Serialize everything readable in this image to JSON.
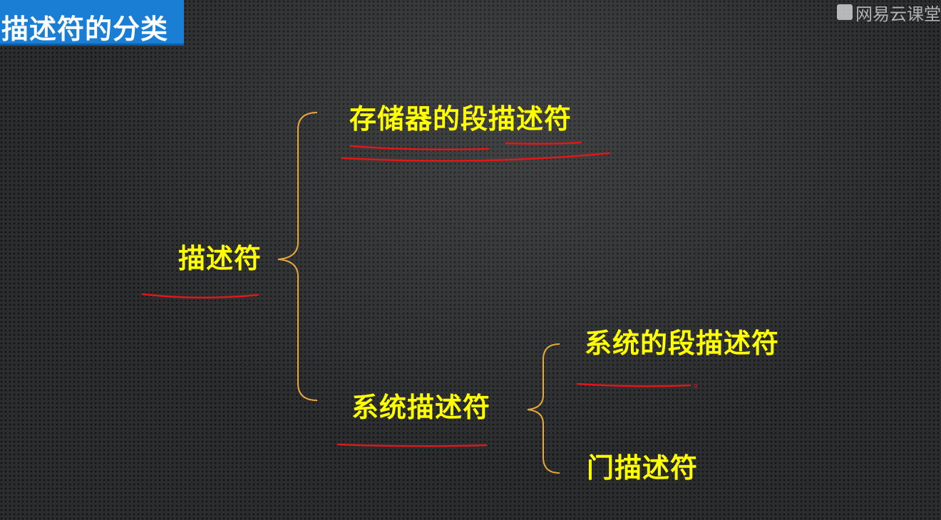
{
  "title": "描述符的分类",
  "watermark": "网易云课堂",
  "tree": {
    "root": "描述符",
    "branches": [
      {
        "label": "存储器的段描述符"
      },
      {
        "label": "系统描述符",
        "children": [
          {
            "label": "系统的段描述符"
          },
          {
            "label": "门描述符"
          }
        ]
      }
    ]
  },
  "colors": {
    "node_text": "#ffff00",
    "bracket": "#e8a93a",
    "annotation_underline": "#e01818",
    "title_banner": "#1a7fd4"
  }
}
